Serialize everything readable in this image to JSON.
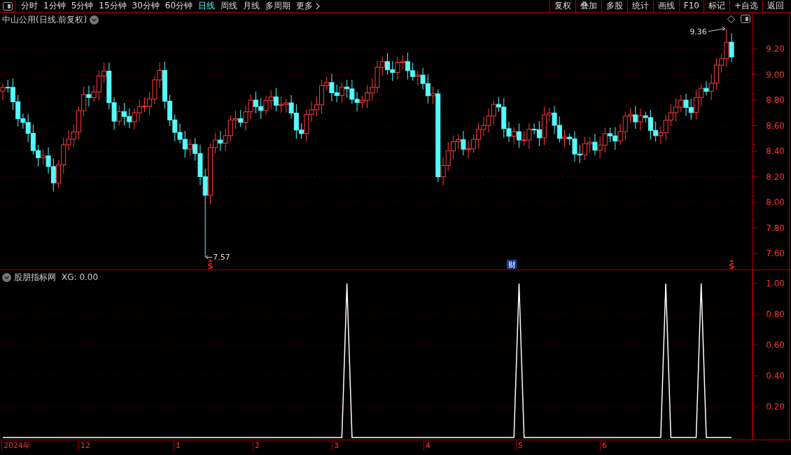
{
  "toolbar": {
    "periods": [
      {
        "label": "分时",
        "selected": false
      },
      {
        "label": "1分钟",
        "selected": false
      },
      {
        "label": "5分钟",
        "selected": false
      },
      {
        "label": "15分钟",
        "selected": false
      },
      {
        "label": "30分钟",
        "selected": false
      },
      {
        "label": "60分钟",
        "selected": false
      },
      {
        "label": "日线",
        "selected": true
      },
      {
        "label": "周线",
        "selected": false
      },
      {
        "label": "月线",
        "selected": false
      },
      {
        "label": "多周期",
        "selected": false
      },
      {
        "label": "更多",
        "selected": false
      }
    ],
    "actions": [
      "复权",
      "叠加",
      "多股",
      "统计",
      "画线",
      "F10",
      "标记",
      "+自选",
      "返回"
    ]
  },
  "main_panel": {
    "title": "中山公用(日线.前复权)",
    "price_axis": [
      "9.20",
      "9.00",
      "8.80",
      "8.60",
      "8.40",
      "8.20",
      "8.00",
      "7.80",
      "7.60"
    ],
    "high_label": "9.36",
    "low_label": "7.57",
    "markers": [
      {
        "kind": "signal",
        "label": "S"
      },
      {
        "kind": "event",
        "label": "财"
      },
      {
        "kind": "signal",
        "label": "S"
      }
    ]
  },
  "indicator_panel": {
    "title": "股朋指标网",
    "reading": ": 0.00",
    "chart_data": {
      "type": "line",
      "grid": true,
      "ylim": [
        -0.014,
        1.086
      ],
      "yticks": [
        {
          "value": 0.2,
          "label": "0.20"
        },
        {
          "value": 0.4,
          "label": "0.40"
        },
        {
          "value": 0.6,
          "label": "0.60"
        },
        {
          "value": 0.8,
          "label": "0.80"
        },
        {
          "value": 1,
          "label": "1.00"
        }
      ],
      "series": [
        {
          "name": "XG",
          "color": "#ffffff",
          "values": [
            0,
            0,
            0,
            0,
            0,
            0,
            0,
            0,
            0,
            0,
            0,
            0,
            0,
            0,
            0,
            0,
            0,
            0,
            0,
            0,
            0,
            0,
            0,
            0,
            0,
            0,
            0,
            0,
            0,
            0,
            0,
            0,
            0,
            0,
            0,
            0,
            0,
            0,
            0,
            0,
            0,
            0,
            0,
            0,
            0,
            0,
            0,
            0,
            0,
            0,
            0,
            0,
            0,
            0,
            0,
            0,
            0,
            0,
            0,
            0,
            0,
            0,
            0,
            0,
            0,
            0,
            0,
            0,
            1,
            0,
            0,
            0,
            0,
            0,
            0,
            0,
            0,
            0,
            0,
            0,
            0,
            0,
            0,
            0,
            0,
            0,
            0,
            0,
            0,
            0,
            0,
            0,
            0,
            0,
            0,
            0,
            0,
            0,
            0,
            0,
            0,
            0,
            1,
            0,
            0,
            0,
            0,
            0,
            0,
            0,
            0,
            0,
            0,
            0,
            0,
            0,
            0,
            0,
            0,
            0,
            0,
            0,
            0,
            0,
            0,
            0,
            0,
            0,
            0,
            0,
            0,
            1,
            0,
            0,
            0,
            0,
            0,
            0,
            1,
            0,
            0,
            0,
            0,
            0,
            0
          ]
        }
      ]
    }
  },
  "date_axis": [
    "2024年",
    "12",
    "1",
    "2",
    "3",
    "4",
    "5",
    "6"
  ]
}
